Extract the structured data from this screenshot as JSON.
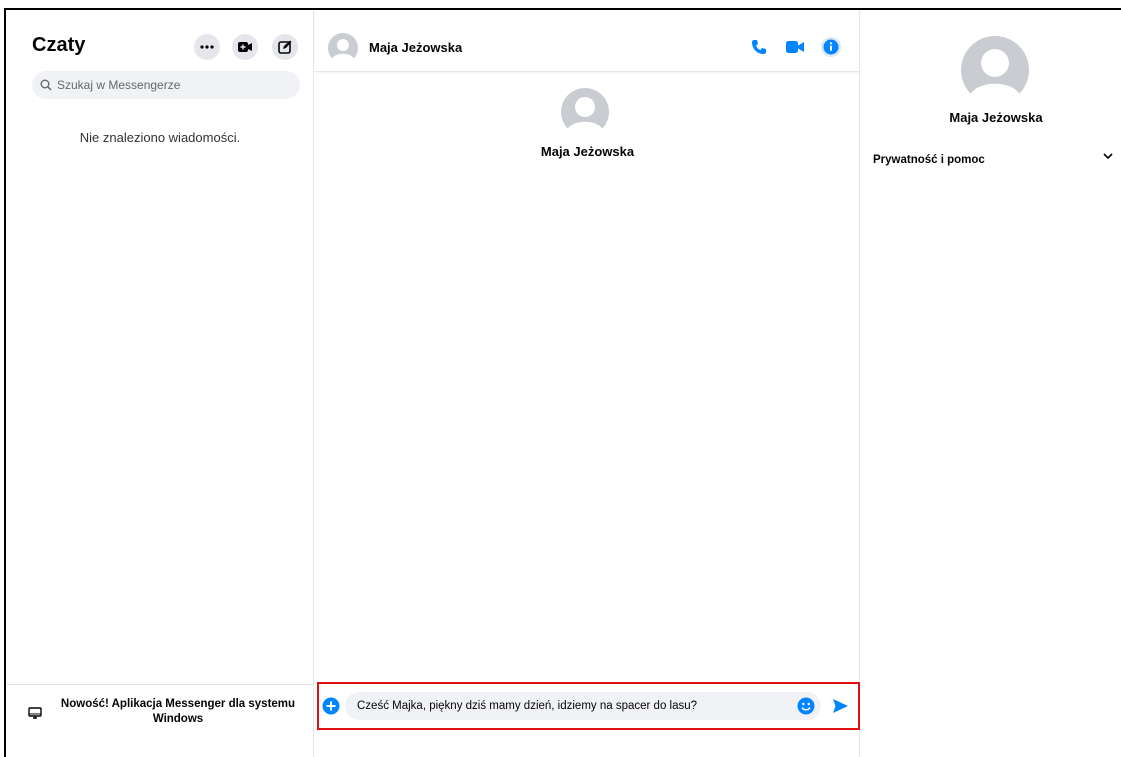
{
  "sidebar": {
    "title": "Czaty",
    "buttons": {
      "more": "more-icon",
      "new_video": "video-plus-icon",
      "compose": "compose-icon"
    },
    "search_placeholder": "Szukaj w Messengerze",
    "empty_message": "Nie znaleziono wiadomości.",
    "promo_text": "Nowość! Aplikacja Messenger dla systemu Windows"
  },
  "chat": {
    "contact_name": "Maja Jeżowska",
    "profile_name": "Maja Jeżowska",
    "composer_value": "Cześć Majka, piękny dziś mamy dzień, idziemy na spacer do lasu?"
  },
  "info_panel": {
    "name": "Maja Jeżowska",
    "section_label": "Prywatność i pomoc"
  },
  "colors": {
    "accent": "#0084ff",
    "highlight_border": "#e01010",
    "input_bg": "#f0f2f5",
    "button_bg": "#e4e6eb"
  }
}
